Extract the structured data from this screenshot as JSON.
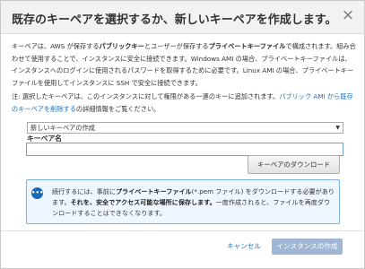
{
  "dialog": {
    "title": "既存のキーペアを選択するか、新しいキーペアを作成します。",
    "close_symbol": "×"
  },
  "description": {
    "part1": "キーペアは、AWS が保存する",
    "bold1": "パブリックキー",
    "part2": "とユーザーが保存する",
    "bold2": "プライベートキーファイル",
    "part3": "で構成されます。組み合わせて使用することで、インスタンスに安全に接続できます。Windows AMI の場合、プライベートキーファイルは、インスタンスへのログインに使用されるパスワードを取得するために必要です。Linux AMI の場合、プライベートキーファイルを使用してインスタンスに SSH で安全に接続できます。"
  },
  "note": {
    "text1": "注: 選択したキーペアは、このインスタンスに対して権限がある一連のキーに追加されます。",
    "link": "パブリック AMI から既存のキーペアを削除する",
    "text2": "の詳細情報をご覧ください。"
  },
  "key_pair_select": {
    "selected": "新しいキーペアの作成",
    "arrow": "▼"
  },
  "key_name": {
    "label": "キーペア名",
    "value": "",
    "placeholder": ""
  },
  "download_button": {
    "label": "キーペアのダウンロード"
  },
  "info": {
    "icon": "•••",
    "text1": "続行するには、事前に",
    "bold1": "プライベートキーファイル",
    "text2": "(*.pem ファイル) をダウンロードする必要があります。",
    "bold2": "それを、安全でアクセス可能な場所に保存します。",
    "text3": "一度作成されると、ファイルを再度ダウンロードすることはできなくなります。"
  },
  "footer": {
    "cancel_label": "キャンセル",
    "launch_label": "インスタンスの作成"
  },
  "colors": {
    "link": "#1e72c2",
    "primary_disabled": "#9fb7d4",
    "info_background": "#eef6ff",
    "info_border": "#7fb0e0",
    "info_icon": "#1a69b6"
  }
}
